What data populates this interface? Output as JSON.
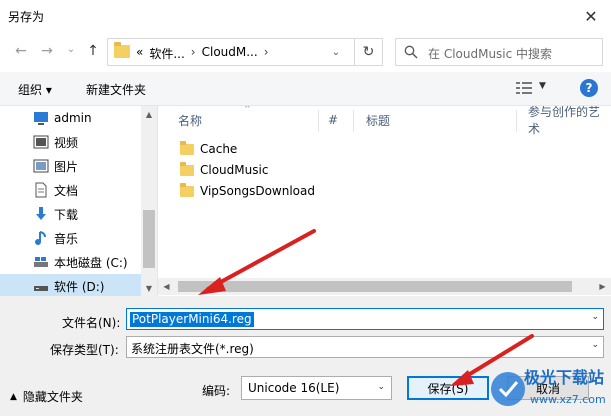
{
  "window": {
    "title": "另存为",
    "close_glyph": "✕"
  },
  "nav": {
    "back_glyph": "←",
    "forward_glyph": "→",
    "recent_glyph": "⌄",
    "up_glyph": "↑",
    "address": {
      "crumbs": [
        "«",
        "软件...",
        "›",
        "CloudM...",
        "›"
      ]
    },
    "refresh_glyph": "↻",
    "search_placeholder": "在 CloudMusic 中搜索"
  },
  "toolbar": {
    "organize": "组织 ▾",
    "new_folder": "新建文件夹",
    "view_dd": "▼",
    "help": "?"
  },
  "sidebar": {
    "items": [
      {
        "label": "admin",
        "icon": "monitor-icon"
      },
      {
        "label": "视频",
        "icon": "video-icon"
      },
      {
        "label": "图片",
        "icon": "picture-icon"
      },
      {
        "label": "文档",
        "icon": "document-icon"
      },
      {
        "label": "下载",
        "icon": "download-icon"
      },
      {
        "label": "音乐",
        "icon": "music-icon"
      },
      {
        "label": "本地磁盘 (C:)",
        "icon": "drive-icon"
      },
      {
        "label": "软件 (D:)",
        "icon": "drive-icon"
      }
    ]
  },
  "files": {
    "columns": [
      "名称",
      "#",
      "标题",
      "参与创作的艺术"
    ],
    "items": [
      "Cache",
      "CloudMusic",
      "VipSongsDownload"
    ]
  },
  "form": {
    "filename_label": "文件名(N):",
    "filename_value": "PotPlayerMini64.reg",
    "filetype_label": "保存类型(T):",
    "filetype_value": "系统注册表文件(*.reg)",
    "hide_folders": "隐藏文件夹",
    "encoding_label": "编码:",
    "encoding_value": "Unicode 16(LE)",
    "save_button": "保存(S)",
    "cancel_button": "取消"
  },
  "watermark": {
    "text": "极光下载站",
    "sub": "www.xz7.com"
  },
  "colors": {
    "accent": "#0078d7",
    "selected": "#cce4f7",
    "arrow": "#d9211f"
  }
}
